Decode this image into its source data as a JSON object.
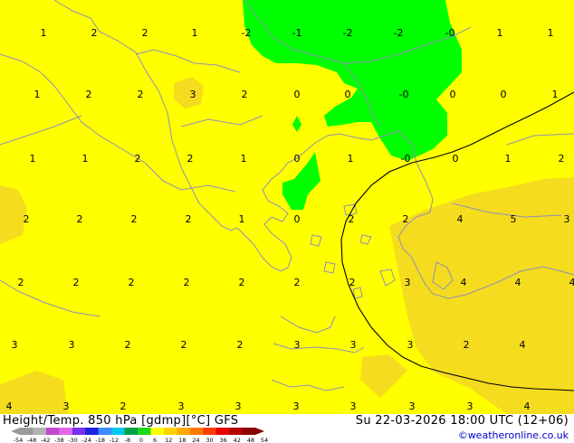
{
  "header": {
    "title": "Height/Temp. 850 hPa [gdmp][°C] GFS",
    "datetime": "Su 22-03-2026 18:00 UTC (12+06)",
    "credit": "©weatheronline.co.uk"
  },
  "legend": {
    "ticks": [
      "-54",
      "-48",
      "-42",
      "-38",
      "-30",
      "-24",
      "-18",
      "-12",
      "-8",
      "0",
      "6",
      "12",
      "18",
      "24",
      "30",
      "36",
      "42",
      "48",
      "54"
    ],
    "colors": [
      "#9a9a9a",
      "#b4b4b4",
      "#c24bcf",
      "#e468e6",
      "#7b2ff0",
      "#2020e0",
      "#3c8cff",
      "#00c8f0",
      "#00a046",
      "#18d818",
      "#ffff00",
      "#ffd200",
      "#ffaa00",
      "#ff7800",
      "#ff3c00",
      "#e60000",
      "#b40000",
      "#8c0000"
    ]
  },
  "colors": {
    "warm_fill": "#ffff00",
    "warmer_fill": "#f5dc1e",
    "zero_fill": "#00ff00",
    "coast": "#9090b8",
    "isoline": "#000000"
  },
  "grid_values": [
    [
      "1",
      "2",
      "2",
      "1",
      "-2",
      "-1",
      "-2",
      "-2",
      "-0",
      "1",
      "1"
    ],
    [
      "1",
      "2",
      "2",
      "3",
      "2",
      "0",
      "0",
      "-0",
      "0",
      "0",
      "1"
    ],
    [
      "1",
      "1",
      "2",
      "2",
      "1",
      "0",
      "1",
      "-0",
      "0",
      "1",
      "2"
    ],
    [
      "2",
      "2",
      "2",
      "2",
      "1",
      "0",
      "2",
      "2",
      "4",
      "5",
      "3"
    ],
    [
      "2",
      "2",
      "2",
      "2",
      "2",
      "2",
      "2",
      "3",
      "4",
      "4",
      "4"
    ],
    [
      "3",
      "3",
      "2",
      "2",
      "2",
      "3",
      "3",
      "3",
      "2",
      "4"
    ],
    [
      "4",
      "3",
      "2",
      "3",
      "3",
      "3",
      "3",
      "3",
      "3",
      "4"
    ]
  ]
}
